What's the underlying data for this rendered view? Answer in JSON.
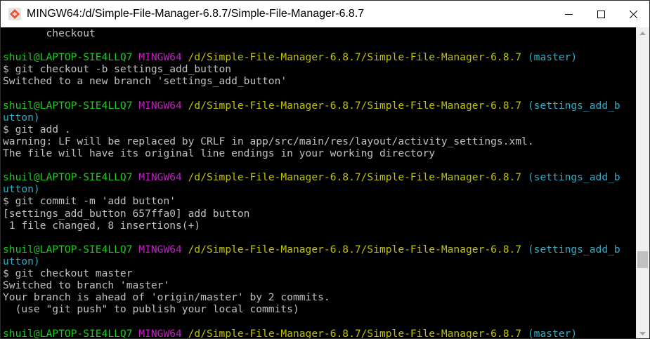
{
  "window": {
    "title": "MINGW64:/d/Simple-File-Manager-6.8.7/Simple-File-Manager-6.8.7"
  },
  "colors": {
    "default_text": "#c0c0c0",
    "user": "#1cc91c",
    "mingw": "#c01fc0",
    "path": "#c0c000",
    "branch": "#2dadc8"
  },
  "terminal": {
    "lines": [
      {
        "segments": [
          {
            "text": "       checkout",
            "color": "default_text"
          }
        ]
      },
      {
        "segments": []
      },
      {
        "segments": [
          {
            "text": "shuil@LAPTOP-SIE4LLQ7",
            "color": "user"
          },
          {
            "text": " ",
            "color": "default_text"
          },
          {
            "text": "MINGW64",
            "color": "mingw"
          },
          {
            "text": " ",
            "color": "default_text"
          },
          {
            "text": "/d/Simple-File-Manager-6.8.7/Simple-File-Manager-6.8.7",
            "color": "path"
          },
          {
            "text": " ",
            "color": "default_text"
          },
          {
            "text": "(master)",
            "color": "branch"
          }
        ]
      },
      {
        "segments": [
          {
            "text": "$ git checkout -b settings_add_button",
            "color": "default_text"
          }
        ]
      },
      {
        "segments": [
          {
            "text": "Switched to a new branch 'settings_add_button'",
            "color": "default_text"
          }
        ]
      },
      {
        "segments": []
      },
      {
        "segments": [
          {
            "text": "shuil@LAPTOP-SIE4LLQ7",
            "color": "user"
          },
          {
            "text": " ",
            "color": "default_text"
          },
          {
            "text": "MINGW64",
            "color": "mingw"
          },
          {
            "text": " ",
            "color": "default_text"
          },
          {
            "text": "/d/Simple-File-Manager-6.8.7/Simple-File-Manager-6.8.7",
            "color": "path"
          },
          {
            "text": " ",
            "color": "default_text"
          },
          {
            "text": "(settings_add_b",
            "color": "branch"
          }
        ]
      },
      {
        "segments": [
          {
            "text": "utton)",
            "color": "branch"
          }
        ]
      },
      {
        "segments": [
          {
            "text": "$ git add .",
            "color": "default_text"
          }
        ]
      },
      {
        "segments": [
          {
            "text": "warning: LF will be replaced by CRLF in app/src/main/res/layout/activity_settings.xml.",
            "color": "default_text"
          }
        ]
      },
      {
        "segments": [
          {
            "text": "The file will have its original line endings in your working directory",
            "color": "default_text"
          }
        ]
      },
      {
        "segments": []
      },
      {
        "segments": [
          {
            "text": "shuil@LAPTOP-SIE4LLQ7",
            "color": "user"
          },
          {
            "text": " ",
            "color": "default_text"
          },
          {
            "text": "MINGW64",
            "color": "mingw"
          },
          {
            "text": " ",
            "color": "default_text"
          },
          {
            "text": "/d/Simple-File-Manager-6.8.7/Simple-File-Manager-6.8.7",
            "color": "path"
          },
          {
            "text": " ",
            "color": "default_text"
          },
          {
            "text": "(settings_add_b",
            "color": "branch"
          }
        ]
      },
      {
        "segments": [
          {
            "text": "utton)",
            "color": "branch"
          }
        ]
      },
      {
        "segments": [
          {
            "text": "$ git commit -m 'add button'",
            "color": "default_text"
          }
        ]
      },
      {
        "segments": [
          {
            "text": "[settings_add_button 657ffa0] add button",
            "color": "default_text"
          }
        ]
      },
      {
        "segments": [
          {
            "text": " 1 file changed, 8 insertions(+)",
            "color": "default_text"
          }
        ]
      },
      {
        "segments": []
      },
      {
        "segments": [
          {
            "text": "shuil@LAPTOP-SIE4LLQ7",
            "color": "user"
          },
          {
            "text": " ",
            "color": "default_text"
          },
          {
            "text": "MINGW64",
            "color": "mingw"
          },
          {
            "text": " ",
            "color": "default_text"
          },
          {
            "text": "/d/Simple-File-Manager-6.8.7/Simple-File-Manager-6.8.7",
            "color": "path"
          },
          {
            "text": " ",
            "color": "default_text"
          },
          {
            "text": "(settings_add_b",
            "color": "branch"
          }
        ]
      },
      {
        "segments": [
          {
            "text": "utton)",
            "color": "branch"
          }
        ]
      },
      {
        "segments": [
          {
            "text": "$ git checkout master",
            "color": "default_text"
          }
        ]
      },
      {
        "segments": [
          {
            "text": "Switched to branch 'master'",
            "color": "default_text"
          }
        ]
      },
      {
        "segments": [
          {
            "text": "Your branch is ahead of 'origin/master' by 2 commits.",
            "color": "default_text"
          }
        ]
      },
      {
        "segments": [
          {
            "text": "  (use \"git push\" to publish your local commits)",
            "color": "default_text"
          }
        ]
      },
      {
        "segments": []
      },
      {
        "segments": [
          {
            "text": "shuil@LAPTOP-SIE4LLQ7",
            "color": "user"
          },
          {
            "text": " ",
            "color": "default_text"
          },
          {
            "text": "MINGW64",
            "color": "mingw"
          },
          {
            "text": " ",
            "color": "default_text"
          },
          {
            "text": "/d/Simple-File-Manager-6.8.7/Simple-File-Manager-6.8.7",
            "color": "path"
          },
          {
            "text": " ",
            "color": "default_text"
          },
          {
            "text": "(master)",
            "color": "branch"
          }
        ]
      }
    ]
  },
  "scrollbar": {
    "position": 0.78
  }
}
